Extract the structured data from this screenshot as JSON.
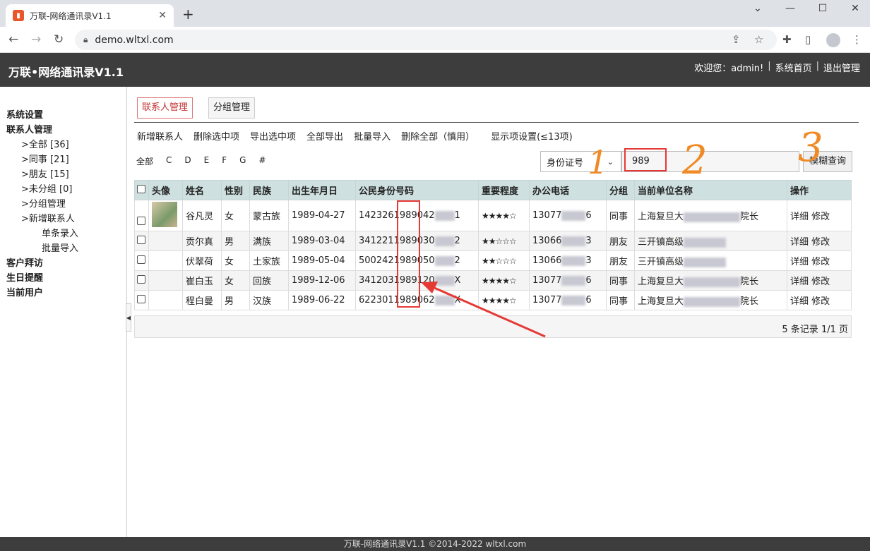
{
  "browser": {
    "tab_title": "万联-网络通讯录V1.1",
    "tab_close": "✕",
    "new_tab": "+",
    "url": "demo.wltxl.com"
  },
  "header": {
    "title": "万联•网络通讯录V1.1",
    "welcome": "欢迎您：admin!",
    "sep": "|",
    "home": "系统首页",
    "logout": "退出管理"
  },
  "sidebar": {
    "system": "系统设置",
    "contacts": "联系人管理",
    "all": ">全部 [36]",
    "colleague": ">同事 [21]",
    "friend": ">朋友 [15]",
    "ungrouped": ">未分组 [0]",
    "group_mgmt": ">分组管理",
    "add_contact": ">新增联系人",
    "single_entry": "单条录入",
    "batch_import": "批量导入",
    "visit": "客户拜访",
    "birthday": "生日提醒",
    "current_user": "当前用户"
  },
  "tabs": {
    "contacts": "联系人管理",
    "groups": "分组管理"
  },
  "actions": [
    "新增联系人",
    "删除选中项",
    "导出选中项",
    "全部导出",
    "批量导入",
    "删除全部（慎用）",
    "显示项设置(≤13项)"
  ],
  "letters": [
    "全部",
    "C",
    "D",
    "E",
    "F",
    "G",
    "#"
  ],
  "search": {
    "field": "身份证号",
    "value": "989",
    "button": "模糊查询"
  },
  "table": {
    "headers": [
      "头像",
      "姓名",
      "性别",
      "民族",
      "出生年月日",
      "公民身份号码",
      "重要程度",
      "办公电话",
      "分组",
      "当前单位名称",
      "操作"
    ],
    "rows": [
      {
        "name": "谷凡灵",
        "gender": "女",
        "ethnic": "蒙古族",
        "birth": "1989-04-27",
        "id_a": "1423261989042",
        "id_b": "1",
        "stars": "★★★★☆",
        "phone_a": "13077",
        "phone_b": "6",
        "group": "同事",
        "org_a": "上海复旦大",
        "org_b": "院长",
        "ops": "详细 修改"
      },
      {
        "name": "贡尔真",
        "gender": "男",
        "ethnic": "满族",
        "birth": "1989-03-04",
        "id_a": "3412211989030",
        "id_b": "2",
        "stars": "★★☆☆☆",
        "phone_a": "13066",
        "phone_b": "3",
        "group": "朋友",
        "org_a": "三开镇高级",
        "org_b": "",
        "ops": "详细 修改"
      },
      {
        "name": "伏翠荷",
        "gender": "女",
        "ethnic": "土家族",
        "birth": "1989-05-04",
        "id_a": "5002421989050",
        "id_b": "2",
        "stars": "★★☆☆☆",
        "phone_a": "13066",
        "phone_b": "3",
        "group": "朋友",
        "org_a": "三开镇高级",
        "org_b": "",
        "ops": "详细 修改"
      },
      {
        "name": "崔白玉",
        "gender": "女",
        "ethnic": "回族",
        "birth": "1989-12-06",
        "id_a": "3412031989120",
        "id_b": "X",
        "stars": "★★★★☆",
        "phone_a": "13077",
        "phone_b": "6",
        "group": "同事",
        "org_a": "上海复旦大",
        "org_b": "院长",
        "ops": "详细 修改"
      },
      {
        "name": "程白曼",
        "gender": "男",
        "ethnic": "汉族",
        "birth": "1989-06-22",
        "id_a": "6223011989062",
        "id_b": "X",
        "stars": "★★★★☆",
        "phone_a": "13077",
        "phone_b": "6",
        "group": "同事",
        "org_a": "上海复旦大",
        "org_b": "院长",
        "ops": "详细 修改"
      }
    ],
    "summary": "5 条记录 1/1 页"
  },
  "annotations": [
    "1",
    "2",
    "3"
  ],
  "footer": "万联-网络通讯录V1.1 ©2014-2022 wltxl.com",
  "colors": {
    "accent_red": "#e53935",
    "header_bg": "#3d3d3d",
    "table_head": "#cfe0e0",
    "annotation_orange": "#f08a24"
  }
}
